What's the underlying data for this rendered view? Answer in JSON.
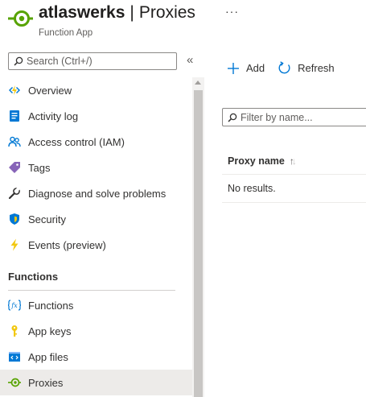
{
  "header": {
    "resource_name": "atlaswerks",
    "separator": "|",
    "page_title": "Proxies",
    "more_label": "···",
    "subtitle": "Function App"
  },
  "sidebar": {
    "search_placeholder": "Search (Ctrl+/)",
    "collapse_label": "«",
    "items": [
      {
        "label": "Overview",
        "icon": "lightning-overview-icon"
      },
      {
        "label": "Activity log",
        "icon": "activity-log-icon"
      },
      {
        "label": "Access control (IAM)",
        "icon": "people-icon"
      },
      {
        "label": "Tags",
        "icon": "tag-icon"
      },
      {
        "label": "Diagnose and solve problems",
        "icon": "wrench-icon"
      },
      {
        "label": "Security",
        "icon": "shield-icon"
      },
      {
        "label": "Events (preview)",
        "icon": "bolt-icon"
      }
    ],
    "section": {
      "title": "Functions",
      "items": [
        {
          "label": "Functions",
          "icon": "function-icon"
        },
        {
          "label": "App keys",
          "icon": "key-icon"
        },
        {
          "label": "App files",
          "icon": "code-file-icon"
        },
        {
          "label": "Proxies",
          "icon": "proxy-icon",
          "active": true
        }
      ]
    }
  },
  "toolbar": {
    "add_label": "Add",
    "refresh_label": "Refresh"
  },
  "filter": {
    "placeholder": "Filter by name..."
  },
  "grid": {
    "columns": [
      "Proxy name"
    ],
    "sort_glyph_up": "↑",
    "sort_glyph_down": "↓",
    "empty_text": "No results."
  },
  "colors": {
    "accent": "#0078d4",
    "proxy_green": "#57a300",
    "active_bg": "#edebe9"
  }
}
